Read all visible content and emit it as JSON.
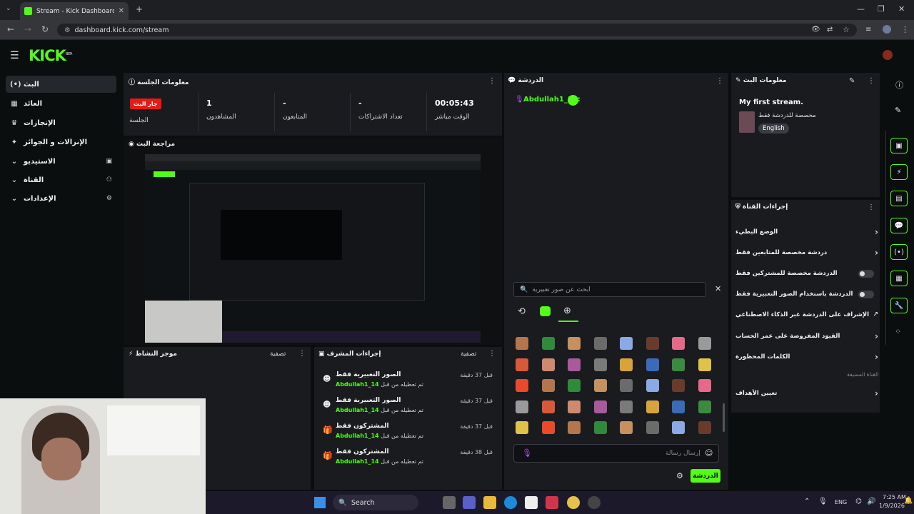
{
  "browser": {
    "tab_title": "Stream - Kick Dashboard",
    "url": "dashboard.kick.com/stream"
  },
  "app": {
    "logo": "KICK",
    "logo_badge": "BETA"
  },
  "sidebar": {
    "items": [
      {
        "label": "البث",
        "icon": "live-icon"
      },
      {
        "label": "العائد",
        "icon": "revenue-icon"
      },
      {
        "label": "الإنجازات",
        "icon": "trophy-icon"
      },
      {
        "label": "الإنزالات و الجوائز",
        "icon": "drops-icon"
      },
      {
        "label": "الاستيديو",
        "icon": "studio-icon"
      },
      {
        "label": "القناة",
        "icon": "channel-icon"
      },
      {
        "label": "الإعدادات",
        "icon": "settings-icon"
      }
    ]
  },
  "session": {
    "title": "معلومات الجلسة",
    "live_badge": "جار البث",
    "stats": [
      {
        "value": "",
        "label": "الجلسة"
      },
      {
        "value": "1",
        "label": "المشاهدون"
      },
      {
        "value": "-",
        "label": "المتابعون"
      },
      {
        "value": "-",
        "label": "تعداد الاشتراكات"
      },
      {
        "value": "00:05:43",
        "label": "الوقت مباشر"
      }
    ]
  },
  "preview": {
    "title": "مراجعة البث"
  },
  "activity": {
    "title": "موجز النشاط",
    "filter": "تصفية"
  },
  "mod_actions": {
    "title": "إجراءات المشرف",
    "filter": "تصفية",
    "items": [
      {
        "title": "الصور التعبيرية فقط",
        "sub": "تم تعطيله من قبل",
        "user": "Abdullah1_14",
        "time": "قبل 37 دقيقة",
        "icon": "emoji-icon"
      },
      {
        "title": "الصور التعبيرية فقط",
        "sub": "تم تعطيله من قبل",
        "user": "Abdullah1_14",
        "time": "قبل 37 دقيقة",
        "icon": "emoji-icon"
      },
      {
        "title": "المشتركون فقط",
        "sub": "تم تعطيله من قبل",
        "user": "Abdullah1_14",
        "time": "قبل 37 دقيقة",
        "icon": "gift-icon"
      },
      {
        "title": "المشتركون فقط",
        "sub": "تم تعطيله من قبل",
        "user": "Abdullah1_14",
        "time": "قبل 38 دقيقة",
        "icon": "gift-icon"
      }
    ]
  },
  "chat": {
    "title": "الدردشة",
    "message_user": "Abdullah1_14:",
    "emote_search_placeholder": "ابحث عن صور تعبيرية",
    "message_placeholder": "إرسال رسالة",
    "send_label": "الدردشة"
  },
  "stream_info": {
    "title": "معلومات البث",
    "stream_title": "My first stream.",
    "category": "مخصصة للدردشة فقط",
    "language": "English"
  },
  "channel_actions": {
    "title": "إجراءات القناة",
    "items": [
      {
        "label": "الوضع البطيء",
        "control": "chevron"
      },
      {
        "label": "دردشة مخصصة للمتابعين فقط",
        "control": "chevron"
      },
      {
        "label": "الدردشة مخصصة للمشتركين فقط",
        "control": "toggle"
      },
      {
        "label": "الدردشة باستخدام الصور التعبيرية فقط",
        "control": "toggle"
      },
      {
        "label": "الإشراف على الدردشة عبر الذكاء الاصطناعي",
        "control": "external"
      },
      {
        "label": "القيود المفروضة على عمر الحساب",
        "control": "chevron"
      },
      {
        "label": "الكلمات المحظورة",
        "control": "chevron"
      }
    ],
    "section_label": "القناة المضيفة",
    "goals_label": "تعيين الأهداف"
  },
  "taskbar": {
    "search": "Search",
    "lang": "ENG",
    "time": "7:25 AM",
    "date": "1/9/2026"
  },
  "colors": {
    "accent": "#53fc18",
    "live": "#e91916"
  }
}
